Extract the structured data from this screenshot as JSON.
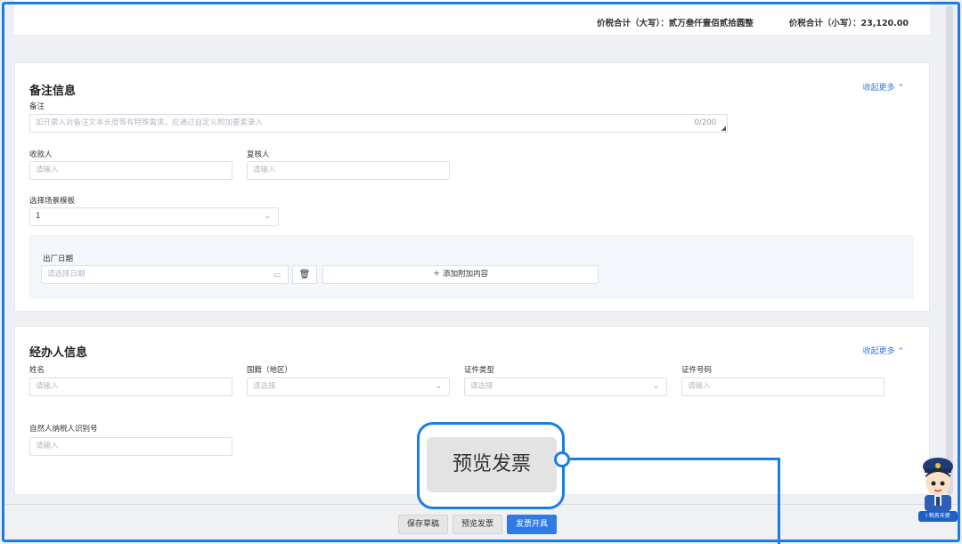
{
  "totals": {
    "upper_label": "价税合计（大写）：",
    "upper_value": "贰万叁仟壹佰贰拾圆整",
    "lower_label": "价税合计（小写）：",
    "lower_value": "23,120.00"
  },
  "remarks": {
    "title": "备注信息",
    "collapse": "收起更多",
    "remark_label": "备注",
    "remark_placeholder": "如开票人对备注文本长度等有特殊需求，应通过自定义附加要素录入",
    "remark_counter": "0/200",
    "payee_label": "收款人",
    "payee_placeholder": "请输入",
    "reviewer_label": "复核人",
    "reviewer_placeholder": "请输入",
    "template_label": "选择场景模板",
    "template_value": "1",
    "factory_date_label": "出厂日期",
    "factory_date_placeholder": "请选择日期",
    "add_content": "添加附加内容"
  },
  "handler": {
    "title": "经办人信息",
    "collapse": "收起更多",
    "name_label": "姓名",
    "name_placeholder": "请输入",
    "country_label": "国籍（地区）",
    "country_placeholder": "请选择",
    "id_type_label": "证件类型",
    "id_type_placeholder": "请选择",
    "id_number_label": "证件号码",
    "id_number_placeholder": "请输入",
    "taxid_label": "自然人纳税人识别号",
    "taxid_placeholder": "请输入"
  },
  "footer": {
    "save_draft": "保存草稿",
    "preview": "预览发票",
    "issue": "发票开具"
  },
  "callout": {
    "text": "预览发票"
  },
  "mascot": {
    "badge_text": "i 税务天使"
  },
  "colors": {
    "accent": "#1a7de6",
    "primary_button": "#2f7be6"
  }
}
